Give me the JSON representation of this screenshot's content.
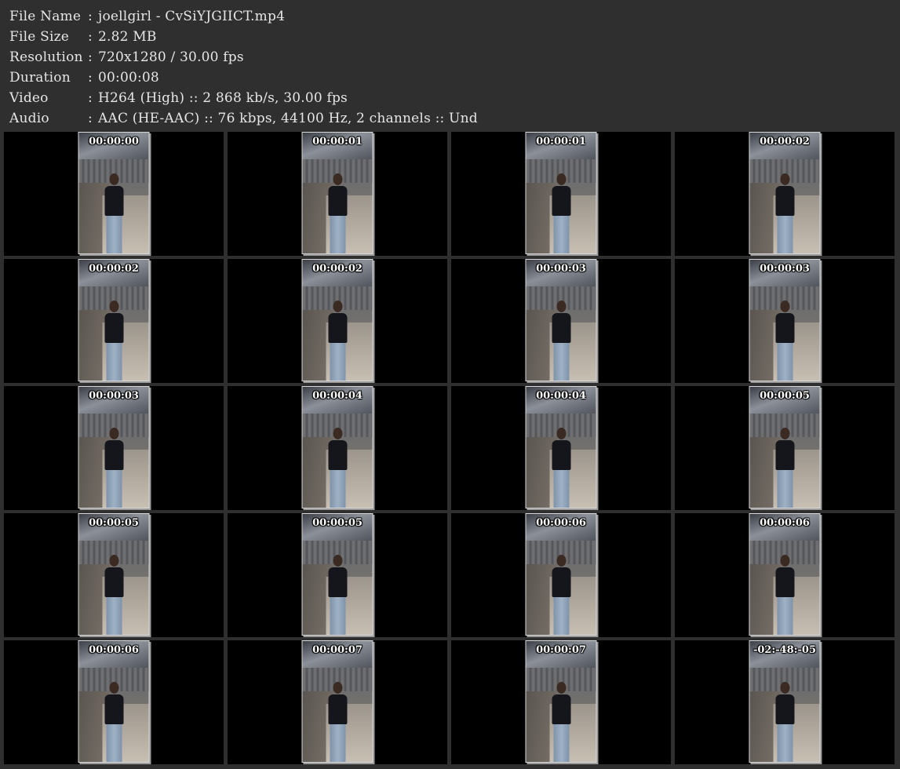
{
  "info": [
    {
      "label": "File Name",
      "sep": ":",
      "value": "joellgirl - CvSiYJGIICT.mp4"
    },
    {
      "label": "File Size",
      "sep": ":",
      "value": "2.82 MB"
    },
    {
      "label": "Resolution",
      "sep": ":",
      "value": "720x1280 / 30.00 fps"
    },
    {
      "label": "Duration",
      "sep": ":",
      "value": "00:00:08"
    },
    {
      "label": "Video",
      "sep": ":",
      "value": "H264 (High) :: 2 868 kb/s, 30.00 fps"
    },
    {
      "label": "Audio",
      "sep": ":",
      "value": "AAC (HE-AAC) :: 76 kbps, 44100 Hz, 2 channels :: Und"
    }
  ],
  "thumbnails": [
    {
      "time": "00:00:00"
    },
    {
      "time": "00:00:01"
    },
    {
      "time": "00:00:01"
    },
    {
      "time": "00:00:02"
    },
    {
      "time": "00:00:02"
    },
    {
      "time": "00:00:02"
    },
    {
      "time": "00:00:03"
    },
    {
      "time": "00:00:03"
    },
    {
      "time": "00:00:03"
    },
    {
      "time": "00:00:04"
    },
    {
      "time": "00:00:04"
    },
    {
      "time": "00:00:05"
    },
    {
      "time": "00:00:05"
    },
    {
      "time": "00:00:05"
    },
    {
      "time": "00:00:06"
    },
    {
      "time": "00:00:06"
    },
    {
      "time": "00:00:06"
    },
    {
      "time": "00:00:07"
    },
    {
      "time": "00:00:07"
    },
    {
      "time": "-02:-48:-05"
    }
  ],
  "colors": {
    "background": "#2f2f2f",
    "cell": "#000000",
    "text": "#e6e6e6"
  }
}
